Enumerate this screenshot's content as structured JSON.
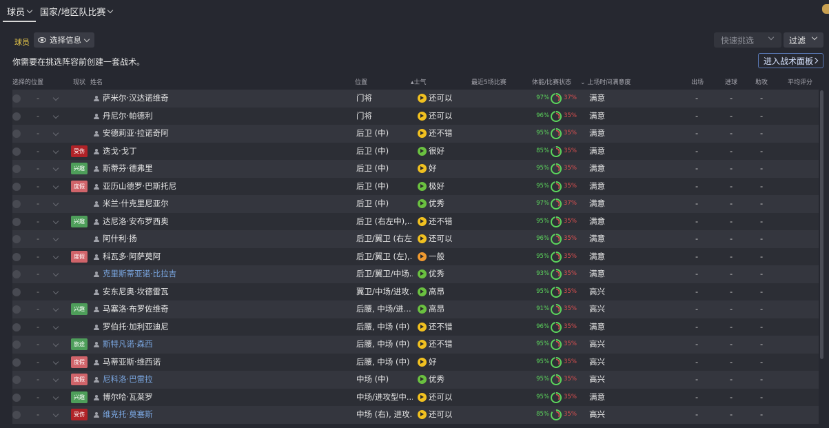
{
  "nav": {
    "tabs": [
      {
        "label": "球员"
      },
      {
        "label": "国家/地区队比赛"
      }
    ]
  },
  "toolbar": {
    "section_label": "球员",
    "select_info_label": "选择信息",
    "notice": "你需要在挑选阵容前创建一套战术。",
    "quick_pick_label": "快速挑选",
    "filter_label": "过滤",
    "tactics_button_label": "进入战术面板"
  },
  "columns": {
    "selected_position": "选择的位置",
    "status": "现状",
    "name": "姓名",
    "position": "位置",
    "morale": "士气",
    "last5": "最近5场比赛",
    "condition": "体能/比赛状态",
    "playing_time": "上场时间满意度",
    "apps": "出场",
    "goals": "进球",
    "assists": "助攻",
    "avg_rating": "平均评分"
  },
  "colors": {
    "condition": "#5cd65c",
    "sharpness": "#e05050",
    "link": "#7aa6e0",
    "section_label": "#e8c84a"
  },
  "players": [
    {
      "sel": "-",
      "badge": "",
      "name": "萨米尔·汉达诺维奇",
      "link": false,
      "position": "门将",
      "morale": "还可以",
      "morale_level": "yellow",
      "condition": "97%",
      "sharpness": "37%",
      "condition_frac": 0.97,
      "sharpness_frac": 0.37,
      "satisfaction": "满意",
      "apps": "-",
      "goals": "-",
      "assists": "-"
    },
    {
      "sel": "-",
      "badge": "",
      "name": "丹尼尔·帕德利",
      "link": false,
      "position": "门将",
      "morale": "还可以",
      "morale_level": "yellow",
      "condition": "96%",
      "sharpness": "35%",
      "condition_frac": 0.96,
      "sharpness_frac": 0.35,
      "satisfaction": "满意",
      "apps": "-",
      "goals": "-",
      "assists": "-"
    },
    {
      "sel": "-",
      "badge": "",
      "name": "安德莉亚·拉诺奇阿",
      "link": false,
      "position": "后卫 (中)",
      "morale": "还不错",
      "morale_level": "yellow",
      "condition": "95%",
      "sharpness": "35%",
      "condition_frac": 0.95,
      "sharpness_frac": 0.35,
      "satisfaction": "满意",
      "apps": "-",
      "goals": "-",
      "assists": "-"
    },
    {
      "sel": "-",
      "badge": "受伤",
      "badge_type": "injured",
      "name": "迭戈·戈丁",
      "link": false,
      "position": "后卫 (中)",
      "morale": "很好",
      "morale_level": "green",
      "condition": "85%",
      "sharpness": "35%",
      "condition_frac": 0.85,
      "sharpness_frac": 0.35,
      "satisfaction": "满意",
      "apps": "-",
      "goals": "-",
      "assists": "-"
    },
    {
      "sel": "-",
      "badge": "兴趣",
      "badge_type": "happy",
      "name": "斯蒂芬·德弗里",
      "link": false,
      "position": "后卫 (中)",
      "morale": "好",
      "morale_level": "yellow",
      "condition": "95%",
      "sharpness": "35%",
      "condition_frac": 0.95,
      "sharpness_frac": 0.35,
      "satisfaction": "满意",
      "apps": "-",
      "goals": "-",
      "assists": "-"
    },
    {
      "sel": "-",
      "badge": "度假",
      "badge_type": "holiday",
      "name": "亚历山德罗·巴斯托尼",
      "link": false,
      "position": "后卫 (中)",
      "morale": "极好",
      "morale_level": "green",
      "condition": "95%",
      "sharpness": "35%",
      "condition_frac": 0.95,
      "sharpness_frac": 0.35,
      "satisfaction": "满意",
      "apps": "-",
      "goals": "-",
      "assists": "-"
    },
    {
      "sel": "-",
      "badge": "",
      "name": "米兰·什克里尼亚尔",
      "link": false,
      "position": "后卫 (中)",
      "morale": "优秀",
      "morale_level": "green",
      "condition": "97%",
      "sharpness": "37%",
      "condition_frac": 0.97,
      "sharpness_frac": 0.37,
      "satisfaction": "满意",
      "apps": "-",
      "goals": "-",
      "assists": "-"
    },
    {
      "sel": "-",
      "badge": "兴趣",
      "badge_type": "happy",
      "name": "达尼洛·安布罗西奥",
      "link": false,
      "position": "后卫 (右左中),...",
      "morale": "还不错",
      "morale_level": "yellow",
      "condition": "95%",
      "sharpness": "35%",
      "condition_frac": 0.95,
      "sharpness_frac": 0.35,
      "satisfaction": "满意",
      "apps": "-",
      "goals": "-",
      "assists": "-"
    },
    {
      "sel": "-",
      "badge": "",
      "name": "阿什利·扬",
      "link": false,
      "position": "后卫/翼卫 (右左)",
      "morale": "还可以",
      "morale_level": "yellow",
      "condition": "96%",
      "sharpness": "35%",
      "condition_frac": 0.96,
      "sharpness_frac": 0.35,
      "satisfaction": "满意",
      "apps": "-",
      "goals": "-",
      "assists": "-"
    },
    {
      "sel": "-",
      "badge": "度假",
      "badge_type": "holiday",
      "name": "科瓦多·阿萨莫阿",
      "link": false,
      "position": "后卫/翼卫 (左),...",
      "morale": "一般",
      "morale_level": "orange",
      "condition": "95%",
      "sharpness": "35%",
      "condition_frac": 0.95,
      "sharpness_frac": 0.35,
      "satisfaction": "满意",
      "apps": "-",
      "goals": "-",
      "assists": "-"
    },
    {
      "sel": "-",
      "badge": "",
      "name": "克里斯蒂亚诺·比拉吉",
      "link": true,
      "position": "后卫/翼卫/中场...",
      "morale": "优秀",
      "morale_level": "green",
      "condition": "93%",
      "sharpness": "35%",
      "condition_frac": 0.93,
      "sharpness_frac": 0.35,
      "satisfaction": "满意",
      "apps": "-",
      "goals": "-",
      "assists": "-"
    },
    {
      "sel": "-",
      "badge": "",
      "name": "安东尼奥·坎德雷瓦",
      "link": false,
      "position": "翼卫/中场/进攻...",
      "morale": "高昂",
      "morale_level": "green",
      "condition": "95%",
      "sharpness": "35%",
      "condition_frac": 0.95,
      "sharpness_frac": 0.35,
      "satisfaction": "高兴",
      "apps": "-",
      "goals": "-",
      "assists": "-"
    },
    {
      "sel": "-",
      "badge": "兴趣",
      "badge_type": "happy",
      "name": "马塞洛·布罗佐维奇",
      "link": false,
      "position": "后腰, 中场/进...",
      "morale": "高昂",
      "morale_level": "green",
      "condition": "91%",
      "sharpness": "35%",
      "condition_frac": 0.91,
      "sharpness_frac": 0.35,
      "satisfaction": "高兴",
      "apps": "-",
      "goals": "-",
      "assists": "-"
    },
    {
      "sel": "-",
      "badge": "",
      "name": "罗伯托·加利亚迪尼",
      "link": false,
      "position": "后腰, 中场 (中)",
      "morale": "还不错",
      "morale_level": "yellow",
      "condition": "96%",
      "sharpness": "35%",
      "condition_frac": 0.96,
      "sharpness_frac": 0.35,
      "satisfaction": "满意",
      "apps": "-",
      "goals": "-",
      "assists": "-"
    },
    {
      "sel": "-",
      "badge": "旅途",
      "badge_type": "happy",
      "name": "斯特凡诺·森西",
      "link": true,
      "position": "后腰, 中场 (中)",
      "morale": "还不错",
      "morale_level": "yellow",
      "condition": "95%",
      "sharpness": "35%",
      "condition_frac": 0.95,
      "sharpness_frac": 0.35,
      "satisfaction": "高兴",
      "apps": "-",
      "goals": "-",
      "assists": "-"
    },
    {
      "sel": "-",
      "badge": "度假",
      "badge_type": "holiday",
      "name": "马蒂亚斯·维西诺",
      "link": false,
      "position": "后腰, 中场 (中)",
      "morale": "好",
      "morale_level": "yellow",
      "condition": "95%",
      "sharpness": "35%",
      "condition_frac": 0.95,
      "sharpness_frac": 0.35,
      "satisfaction": "高兴",
      "apps": "-",
      "goals": "-",
      "assists": "-"
    },
    {
      "sel": "-",
      "badge": "度假",
      "badge_type": "holiday",
      "name": "尼科洛·巴雷拉",
      "link": true,
      "position": "中场 (中)",
      "morale": "优秀",
      "morale_level": "green",
      "condition": "95%",
      "sharpness": "35%",
      "condition_frac": 0.95,
      "sharpness_frac": 0.35,
      "satisfaction": "高兴",
      "apps": "-",
      "goals": "-",
      "assists": "-"
    },
    {
      "sel": "-",
      "badge": "兴趣",
      "badge_type": "happy",
      "name": "博尔哈·瓦莱罗",
      "link": false,
      "position": "中场/进攻型中...",
      "morale": "还可以",
      "morale_level": "yellow",
      "condition": "95%",
      "sharpness": "35%",
      "condition_frac": 0.95,
      "sharpness_frac": 0.35,
      "satisfaction": "满意",
      "apps": "-",
      "goals": "-",
      "assists": "-"
    },
    {
      "sel": "-",
      "badge": "受伤",
      "badge_type": "injured",
      "name": "维克托·莫塞斯",
      "link": true,
      "position": "中场 (右), 进攻...",
      "morale": "还可以",
      "morale_level": "yellow",
      "condition": "85%",
      "sharpness": "35%",
      "condition_frac": 0.85,
      "sharpness_frac": 0.35,
      "satisfaction": "高兴",
      "apps": "-",
      "goals": "-",
      "assists": "-"
    }
  ]
}
